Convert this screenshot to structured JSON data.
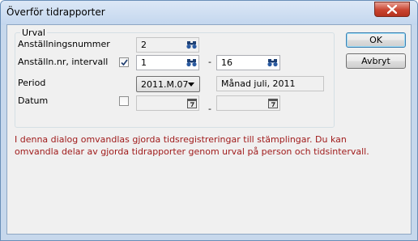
{
  "window": {
    "title": "Överför tidrapporter"
  },
  "group": {
    "title": "Urval"
  },
  "employee": {
    "label": "Anställningsnummer",
    "value": "2"
  },
  "interval": {
    "label": "Anställn.nr, intervall",
    "checked": true,
    "from": "1",
    "to": "16",
    "separator": "-"
  },
  "period": {
    "label": "Period",
    "selected": "2011.M.07",
    "description": "Månad juli, 2011"
  },
  "date": {
    "label": "Datum",
    "checked": false,
    "from": "",
    "to": "",
    "separator": "-"
  },
  "buttons": {
    "ok": "OK",
    "cancel": "Avbryt"
  },
  "info": {
    "line1": "I denna dialog omvandlas gjorda tidsregistreringar till stämplingar. Du kan",
    "line2": "omvandla delar av gjorda tidrapporter genom urval på person och tidsintervall.",
    "color": "#a01c1c"
  },
  "icons": {
    "lookup": "binoculars-icon",
    "calendar": "calendar-icon",
    "close": "close-icon",
    "dropdown": "chevron-down-icon"
  }
}
